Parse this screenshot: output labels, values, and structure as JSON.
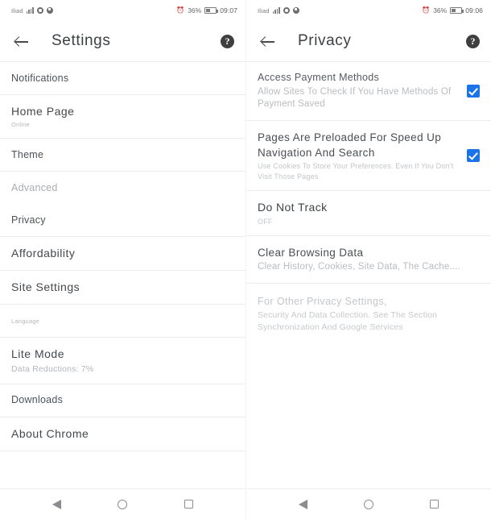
{
  "left": {
    "status": {
      "carrier": "Iliad",
      "signal_icon": "signal-bars-icon",
      "icon_1": "sync-circle-icon",
      "icon_2": "power-circle-icon",
      "alarm_icon": "alarm-icon",
      "battery_pct": "36%",
      "battery_icon": "battery-icon",
      "time": "09:07"
    },
    "appbar": {
      "back_icon": "back-arrow-icon",
      "title": "Settings",
      "help_icon": "help-circle-icon",
      "help_glyph": "?"
    },
    "items": [
      {
        "title": "Notifications",
        "sub": ""
      },
      {
        "title": "Home Page",
        "sub": "Online"
      },
      {
        "title": "Theme",
        "sub": ""
      },
      {
        "title": "Advanced",
        "sub": ""
      },
      {
        "title": "Privacy",
        "sub": ""
      },
      {
        "title": "Affordability",
        "sub": ""
      },
      {
        "title": "Site Settings",
        "sub": ""
      },
      {
        "title": "Language",
        "sub": ""
      },
      {
        "title": "Lite Mode",
        "sub": "Data Reductions: 7%"
      },
      {
        "title": "Downloads",
        "sub": ""
      },
      {
        "title": "About Chrome",
        "sub": ""
      }
    ]
  },
  "right": {
    "status": {
      "carrier": "Iliad",
      "signal_icon": "signal-bars-icon",
      "icon_1": "sync-circle-icon",
      "icon_2": "power-circle-icon",
      "alarm_icon": "alarm-icon",
      "battery_pct": "36%",
      "battery_icon": "battery-icon",
      "time": "09:06"
    },
    "appbar": {
      "back_icon": "back-arrow-icon",
      "title": "Privacy",
      "help_icon": "help-circle-icon",
      "help_glyph": "?"
    },
    "items": [
      {
        "title": "Access Payment Methods",
        "sub": "Allow Sites To Check If You Have Methods Of Payment Saved",
        "checkbox": true
      },
      {
        "title": "Pages Are Preloaded For Speed Up Navigation And Search",
        "sub": "Use Cookies To Store Your Preferences. Even If You Don't Visit Those Pages",
        "checkbox": true
      },
      {
        "title": "Do Not Track",
        "sub": "OFF",
        "checkbox": false
      },
      {
        "title": "Clear Browsing Data",
        "sub": "Clear History, Cookies, Site Data, The Cache....",
        "checkbox": false
      }
    ],
    "footnote": {
      "head": "For Other Privacy Settings,",
      "body": "Security And Data Collection. See The Section Synchronization And Google Services"
    }
  },
  "navbar": {
    "back_icon": "nav-back-icon",
    "home_icon": "nav-home-icon",
    "recents_icon": "nav-recents-icon"
  },
  "colors": {
    "accent": "#1a73e8",
    "divider": "#ececec",
    "title": "#4c5156",
    "subtitle": "#b3b6ba"
  }
}
